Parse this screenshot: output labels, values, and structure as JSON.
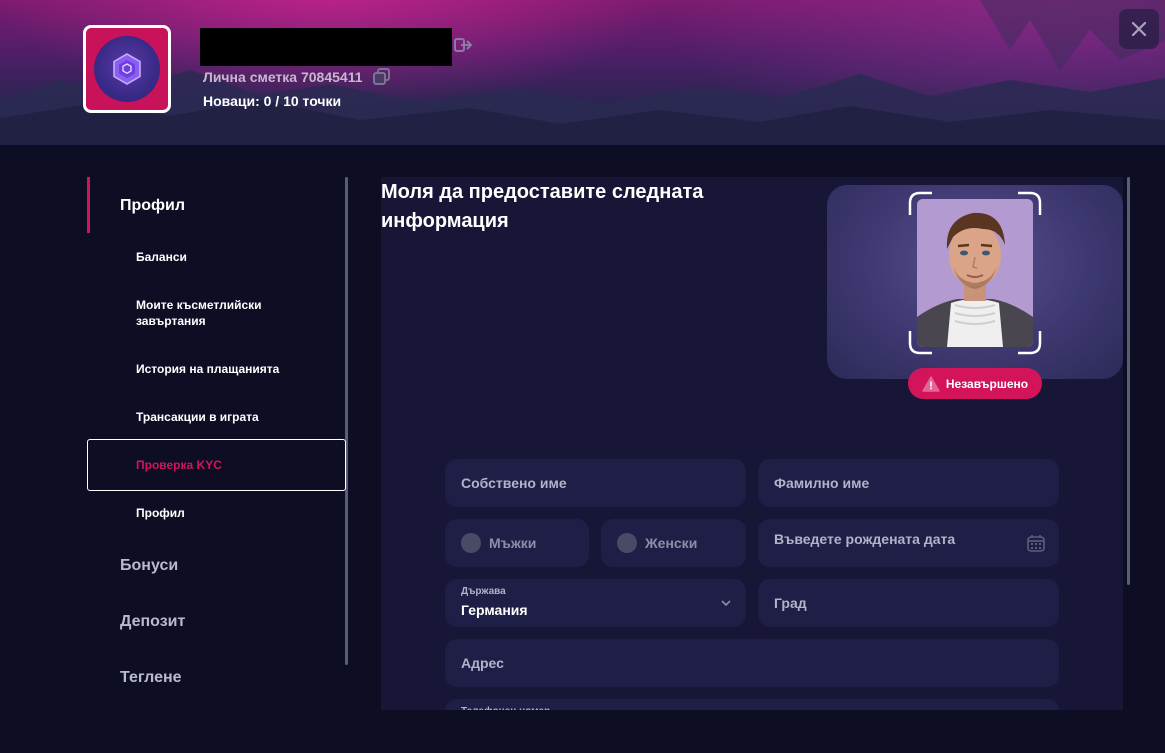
{
  "header": {
    "account_label": "Лична сметка 70845411",
    "points_label": "Новаци: 0  / 10 точки"
  },
  "sidebar": {
    "section_profile": "Профил",
    "sub_items": [
      {
        "label": "Баланси"
      },
      {
        "label": "Моите късметлийски завъртания"
      },
      {
        "label": "История на плащанията"
      },
      {
        "label": "Трансакции в играта"
      },
      {
        "label": "Проверка KYC",
        "active": true
      },
      {
        "label": "Профил"
      }
    ],
    "bonuses": "Бонуси",
    "deposit": "Депозит",
    "withdraw": "Теглене"
  },
  "main": {
    "title": "Моля да предоставите следната информация",
    "status": "Незавършено",
    "status_color": "#d4145a"
  },
  "form": {
    "first_name": "Собствено име",
    "last_name": "Фамилно име",
    "male": "Мъжки",
    "female": "Женски",
    "birth_date": "Въведете рождената дата",
    "country_label": "Държава",
    "country_value": "Германия",
    "city": "Град",
    "address": "Адрес",
    "phone": "Телефонен номер"
  },
  "colors": {
    "accent": "#d4145a",
    "background": "#0d0e24",
    "panel": "#171636",
    "field": "#1f1e47"
  }
}
